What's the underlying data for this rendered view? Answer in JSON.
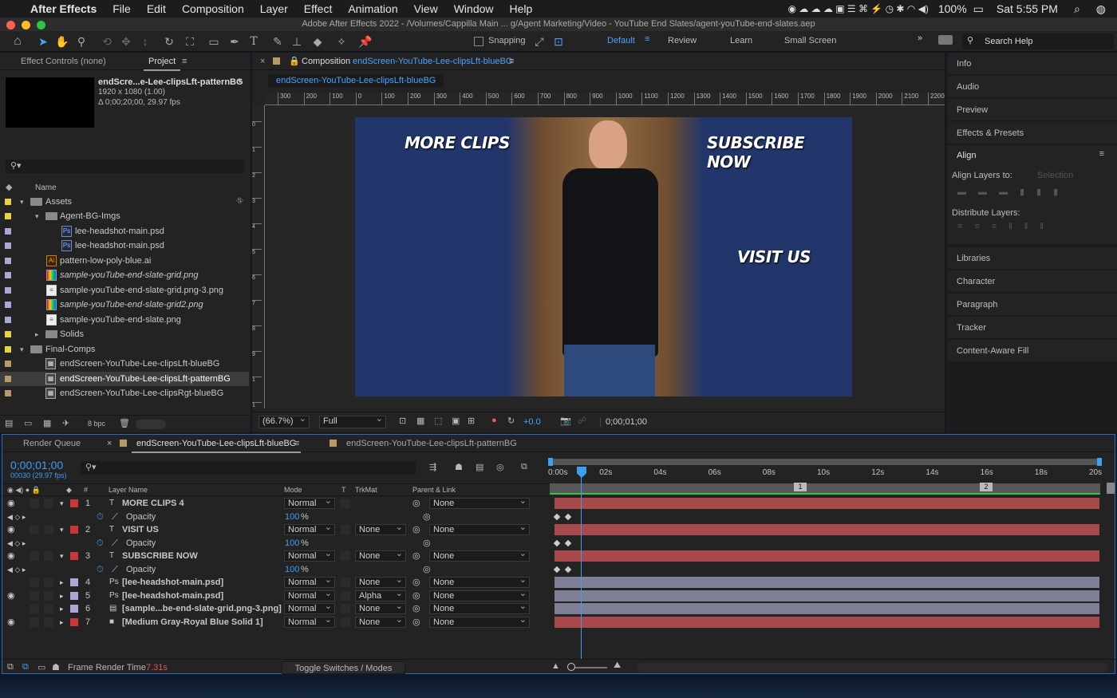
{
  "menubar": {
    "apple": "",
    "app": "After Effects",
    "items": [
      "File",
      "Edit",
      "Composition",
      "Layer",
      "Effect",
      "Animation",
      "View",
      "Window",
      "Help"
    ],
    "battery": "100%",
    "clock": "Sat 5:55 PM"
  },
  "window": {
    "title": "Adobe After Effects 2022 - /Volumes/Cappilla Main ... g/Agent Marketing/Video - YouTube End Slates/agent-youTube-end-slates.aep"
  },
  "toolbar": {
    "snapping": "Snapping",
    "workspaces": [
      "Default",
      "Review",
      "Learn",
      "Small Screen"
    ],
    "search_placeholder": "Search Help"
  },
  "project": {
    "tab_effect": "Effect Controls (none)",
    "tab_project": "Project",
    "preview_name": "endScre...e-Lee-clipsLft-patternBG",
    "preview_size": "1920 x 1080 (1.00)",
    "preview_duration": "Δ 0;00;20;00, 29.97 fps",
    "col_name": "Name",
    "bpc": "8 bpc",
    "items": [
      {
        "label": "Assets",
        "color": "#e6d53c"
      },
      {
        "label": "Agent-BG-Imgs",
        "color": "#e6d53c"
      },
      {
        "label": "lee-headshot-main.psd",
        "color": "#a9a9d6"
      },
      {
        "label": "lee-headshot-main.psd",
        "color": "#a9a9d6"
      },
      {
        "label": "pattern-low-poly-blue.ai",
        "color": "#a9a9d6"
      },
      {
        "label": "sample-youTube-end-slate-grid.png",
        "color": "#a9a9d6"
      },
      {
        "label": "sample-youTube-end-slate-grid.png-3.png",
        "color": "#a9a9d6"
      },
      {
        "label": "sample-youTube-end-slate-grid2.png",
        "color": "#a9a9d6"
      },
      {
        "label": "sample-youTube-end-slate.png",
        "color": "#a9a9d6"
      },
      {
        "label": "Solids",
        "color": "#e6d53c"
      },
      {
        "label": "Final-Comps",
        "color": "#e6d53c"
      },
      {
        "label": "endScreen-YouTube-Lee-clipsLft-blueBG",
        "color": "#b79a6a"
      },
      {
        "label": "endScreen-YouTube-Lee-clipsLft-patternBG",
        "color": "#b79a6a"
      },
      {
        "label": "endScreen-YouTube-Lee-clipsRgt-blueBG",
        "color": "#b79a6a"
      }
    ]
  },
  "comp": {
    "header_prefix": "Composition",
    "header_name": "endScreen-YouTube-Lee-clipsLft-blueBG",
    "tab": "endScreen-YouTube-Lee-clipsLft-blueBG",
    "ruler_ticks": [
      "300",
      "200",
      "100",
      "0",
      "100",
      "200",
      "300",
      "400",
      "500",
      "600",
      "700",
      "800",
      "900",
      "1000",
      "1100",
      "1200",
      "1300",
      "1400",
      "1500",
      "1600",
      "1700",
      "1800",
      "1900",
      "2000",
      "2100",
      "2200"
    ],
    "vruler_ticks": [
      "0",
      "1",
      "2",
      "3",
      "4",
      "5",
      "6",
      "7",
      "8",
      "9",
      "1",
      "1"
    ],
    "overlay_more": "MORE CLIPS",
    "overlay_subscribe": "SUBSCRIBE NOW",
    "overlay_visit": "VISIT US",
    "zoom": "(66.7%)",
    "resolution": "Full",
    "exposure": "+0.0",
    "timecode": "0;00;01;00"
  },
  "right_panel": {
    "sections": [
      "Info",
      "Audio",
      "Preview",
      "Effects & Presets",
      "Align",
      "Libraries",
      "Character",
      "Paragraph",
      "Tracker",
      "Content-Aware Fill"
    ],
    "align_layers_to": "Align Layers to:",
    "align_target": "Selection",
    "distribute": "Distribute Layers:"
  },
  "timeline": {
    "tab_render": "Render Queue",
    "tab_active": "endScreen-YouTube-Lee-clipsLft-blueBG",
    "tab_other": "endScreen-YouTube-Lee-clipsLft-patternBG",
    "timecode": "0;00;01;00",
    "frames": "00030 (29.97 fps)",
    "cols": {
      "num": "#",
      "name": "Layer Name",
      "mode": "Mode",
      "t": "T",
      "trkmat": "TrkMat",
      "parent": "Parent & Link"
    },
    "time_ticks": [
      "0:00s",
      "02s",
      "04s",
      "06s",
      "08s",
      "10s",
      "12s",
      "14s",
      "16s",
      "18s",
      "20s"
    ],
    "markers": [
      "1",
      "2"
    ],
    "layers": [
      {
        "num": "1",
        "type": "T",
        "name": "MORE CLIPS 4",
        "mode": "Normal",
        "trkmat": "",
        "parent": "None",
        "color": "#c8383a",
        "bar": "#a8494b",
        "eye": true,
        "bold": true
      },
      {
        "num": "2",
        "type": "T",
        "name": "VISIT US",
        "mode": "Normal",
        "trkmat": "None",
        "parent": "None",
        "color": "#c8383a",
        "bar": "#a8494b",
        "eye": true,
        "bold": true
      },
      {
        "num": "3",
        "type": "T",
        "name": "SUBSCRIBE NOW",
        "mode": "Normal",
        "trkmat": "None",
        "parent": "None",
        "color": "#c8383a",
        "bar": "#a8494b",
        "eye": true,
        "bold": true
      },
      {
        "num": "4",
        "type": "P",
        "name": "[lee-headshot-main.psd]",
        "mode": "Normal",
        "trkmat": "None",
        "parent": "None",
        "color": "#a9a9d6",
        "bar": "#7f7f98",
        "eye": false,
        "bold": true
      },
      {
        "num": "5",
        "type": "P",
        "name": "[lee-headshot-main.psd]",
        "mode": "Normal",
        "trkmat": "Alpha",
        "parent": "None",
        "color": "#a9a9d6",
        "bar": "#7f7f98",
        "eye": true,
        "bold": true
      },
      {
        "num": "6",
        "type": "F",
        "name": "[sample...be-end-slate-grid.png-3.png]",
        "mode": "Normal",
        "trkmat": "None",
        "parent": "None",
        "color": "#a9a9d6",
        "bar": "#7f7f98",
        "eye": false,
        "bold": true
      },
      {
        "num": "7",
        "type": "S",
        "name": "[Medium Gray-Royal Blue Solid 1]",
        "mode": "Normal",
        "trkmat": "None",
        "parent": "None",
        "color": "#c8383a",
        "bar": "#a8494b",
        "eye": true,
        "bold": true
      }
    ],
    "prop_opacity": "Opacity",
    "prop_value": "100",
    "prop_unit": "%",
    "footer_label": "Frame Render Time",
    "footer_value": "7.31s",
    "toggle": "Toggle Switches / Modes"
  },
  "colors": {
    "accent": "#3f9df4",
    "link": "#6aa6ff",
    "bg": "#232323",
    "comp_bg": "#22366b",
    "timecode": "#3f9df4"
  }
}
